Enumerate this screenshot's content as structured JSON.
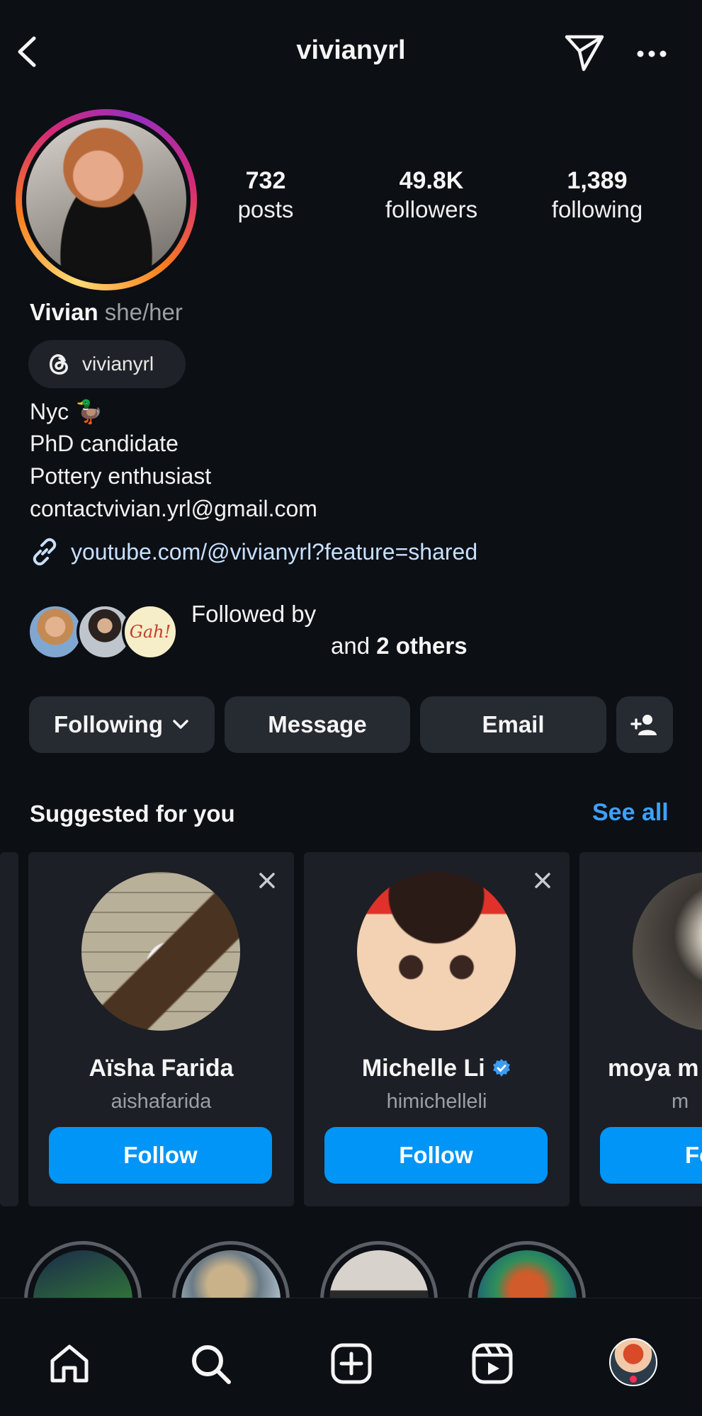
{
  "header": {
    "username": "vivianyrl"
  },
  "stats": [
    {
      "num": "732",
      "label": "posts"
    },
    {
      "num": "49.8K",
      "label": "followers"
    },
    {
      "num": "1,389",
      "label": "following"
    }
  ],
  "profile": {
    "name": "Vivian",
    "pronouns": "she/her",
    "threads_handle": "vivianyrl",
    "bio": [
      "Nyc 🦆",
      "PhD candidate",
      "Pottery enthusiast",
      "contactvivian.yrl@gmail.com"
    ],
    "link": "youtube.com/@vivianyrl?feature=shared"
  },
  "followed_by": {
    "line1": "Followed by",
    "prefix": "and ",
    "others": "2 others",
    "mini3_text": "Gah!"
  },
  "actions": {
    "following": "Following",
    "message": "Message",
    "email": "Email"
  },
  "suggested": {
    "title": "Suggested for you",
    "see_all": "See all",
    "cards": [
      {
        "name": "Aïsha Farida",
        "username": "aishafarida",
        "follow": "Follow"
      },
      {
        "name": "Michelle Li",
        "username": "himichelleli",
        "follow": "Follow",
        "verified": true
      },
      {
        "name": "moya m",
        "username": "m",
        "follow": "Fo"
      }
    ]
  },
  "colors": {
    "accent": "#0095f6",
    "link": "#3da1ff",
    "background": "#0c0f14"
  }
}
